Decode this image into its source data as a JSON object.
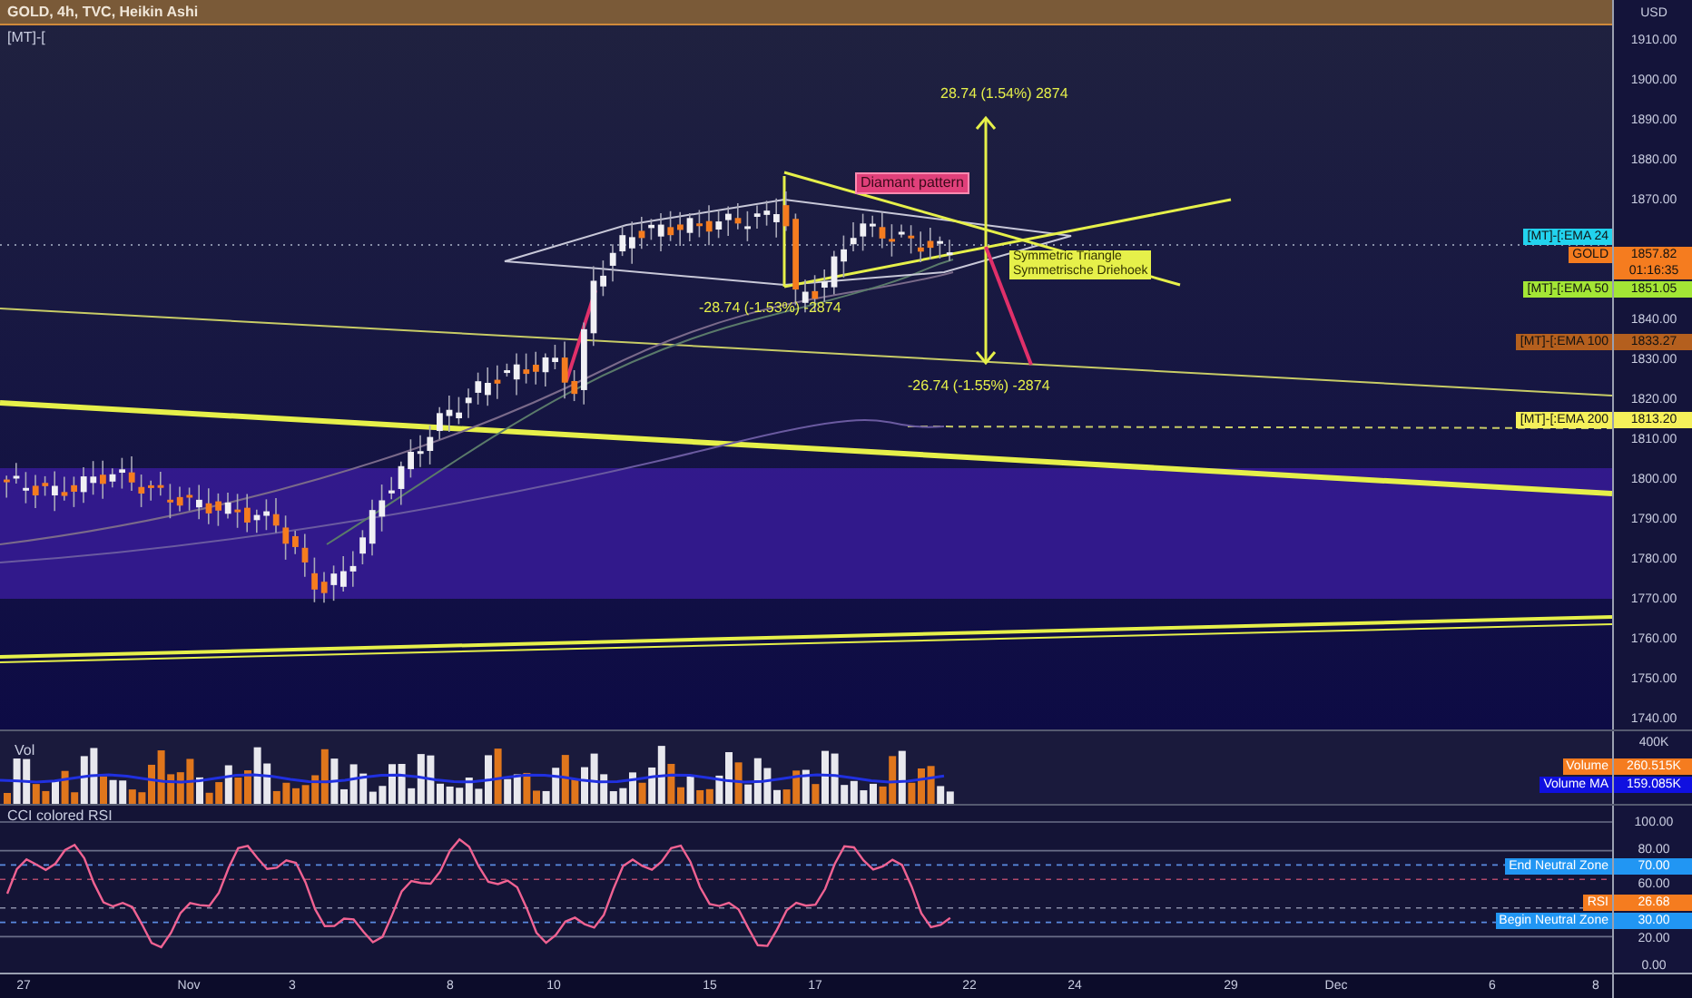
{
  "header": {
    "title": "GOLD, 4h, TVC, Heikin Ashi",
    "indicator": "[MT]-["
  },
  "main_chart": {
    "annotations": [
      {
        "kind": "measure",
        "text": "28.74 (1.54%) 2874"
      },
      {
        "kind": "tag",
        "text": "Diamant pattern"
      },
      {
        "kind": "note",
        "lines": [
          "Symmetric Triangle",
          "Symmetrische Driehoek"
        ]
      },
      {
        "kind": "measure",
        "text": "-28.74 (-1.53%) -2874"
      },
      {
        "kind": "measure",
        "text": "-26.74 (-1.55%) -2874"
      }
    ]
  },
  "price_axis": {
    "unit": "USD",
    "ticks": [
      "1910.00",
      "1900.00",
      "1890.00",
      "1880.00",
      "1870.00",
      "1840.00",
      "1830.00",
      "1820.00",
      "1810.00",
      "1800.00",
      "1790.00",
      "1780.00",
      "1770.00",
      "1760.00",
      "1750.00",
      "1740.00"
    ],
    "labels": [
      {
        "name": "[MT]-[:EMA 24",
        "color": "#22d3ee"
      },
      {
        "name": "GOLD",
        "value": "1857.82",
        "countdown": "01:16:35",
        "color": "#f57c1f"
      },
      {
        "name": "[MT]-[:EMA 50",
        "value": "1851.05",
        "color": "#a3e635"
      },
      {
        "name": "[MT]-[:EMA 100",
        "value": "1833.27",
        "color": "#b45f1e"
      },
      {
        "name": "[MT]-[:EMA 200",
        "value": "1813.20",
        "color": "#f5f05a"
      }
    ]
  },
  "volume": {
    "title": "Vol",
    "axis": "400K",
    "labels": [
      {
        "name": "Volume",
        "value": "260.515K",
        "color": "#f57c1f"
      },
      {
        "name": "Volume MA",
        "value": "159.085K",
        "color": "#1010e0"
      }
    ]
  },
  "cci": {
    "title": "CCI colored RSI",
    "ticks": [
      "100.00",
      "80.00",
      "60.00",
      "20.00",
      "0.00"
    ],
    "labels": [
      {
        "name": "End Neutral Zone",
        "value": "70.00",
        "color": "#2196f3"
      },
      {
        "name": "RSI",
        "value": "26.68",
        "color": "#f57c1f"
      },
      {
        "name": "Begin Neutral Zone",
        "value": "30.00",
        "color": "#2196f3"
      }
    ]
  },
  "time_axis": [
    "27",
    "Nov",
    "3",
    "8",
    "10",
    "15",
    "17",
    "22",
    "24",
    "29",
    "Dec",
    "6",
    "8"
  ]
}
